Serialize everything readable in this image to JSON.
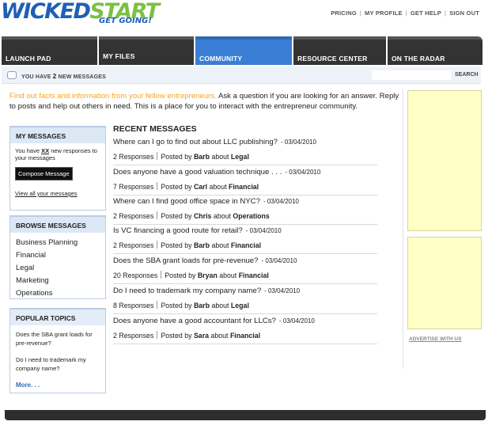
{
  "logo": {
    "main_left": "WICKED",
    "main_right": "START",
    "tagline": "GET GOING!"
  },
  "toplinks": [
    "PRICING",
    "MY PROFILE",
    "GET HELP",
    "SIGN OUT"
  ],
  "nav": [
    "LAUNCH PAD",
    "MY FILES",
    "COMMUNITY",
    "RESOURCE CENTER",
    "ON THE RADAR"
  ],
  "message_bar": {
    "prefix": "YOU HAVE ",
    "count": "2",
    "suffix": " NEW MESSAGES",
    "search_label": "SEARCH",
    "search_value": ""
  },
  "intro": {
    "highlight": "Find out facts and information from your fellow entrepreneurs.",
    "rest": " Ask a question if you are looking for an answer. Reply to posts and help out others in need. This is a place for you to interact with the entrepreneur community."
  },
  "my_messages": {
    "title": "MY MESSAGES",
    "line_pre": "You have ",
    "line_xx": "XX",
    "line_post": " new responses to your messages",
    "compose": "Compose Message",
    "view_all": "View all your messages"
  },
  "browse": {
    "title": "BROWSE MESSAGES",
    "items": [
      "Business Planning",
      "Financial",
      "Legal",
      "Marketing",
      "Operations"
    ]
  },
  "popular": {
    "title": "POPULAR TOPICS",
    "topics": [
      "Does the SBA grant loads for pre-revenue?",
      "Do I need to trademark my company name?"
    ],
    "more": "More. . ."
  },
  "recent": {
    "title": "RECENT MESSAGES",
    "messages": [
      {
        "question": "Where can I go to find out about LLC publishing?",
        "date": "- 03/04/2010",
        "responses": "2 Responses",
        "author": "Barb",
        "category": "Legal"
      },
      {
        "question": "Does anyone have a good valuation technique . . .",
        "date": "- 03/04/2010",
        "responses": "7 Responses",
        "author": "Carl",
        "category": "Financial"
      },
      {
        "question": "Where can I find good office space in NYC?",
        "date": "- 03/04/2010",
        "responses": "2 Responses",
        "author": "Chris",
        "category": "Operations"
      },
      {
        "question": "Is VC financing a good route for retail?",
        "date": "- 03/04/2010",
        "responses": "2 Responses",
        "author": "Barb",
        "category": "Financial"
      },
      {
        "question": "Does the SBA grant loads for pre-revenue?",
        "date": "- 03/04/2010",
        "responses": "20 Responses",
        "author": "Bryan",
        "category": "Financial"
      },
      {
        "question": "Do I need to trademark my company name?",
        "date": "- 03/04/2010",
        "responses": "8 Responses",
        "author": "Barb",
        "category": "Legal"
      },
      {
        "question": "Does anyone have a good accountant for LLCs?",
        "date": "- 03/04/2010",
        "responses": "2 Responses",
        "author": "Sara",
        "category": "Financial"
      }
    ],
    "posted_by": "Posted by",
    "about": "about"
  },
  "advertise": "ADVERTISE WITH US"
}
